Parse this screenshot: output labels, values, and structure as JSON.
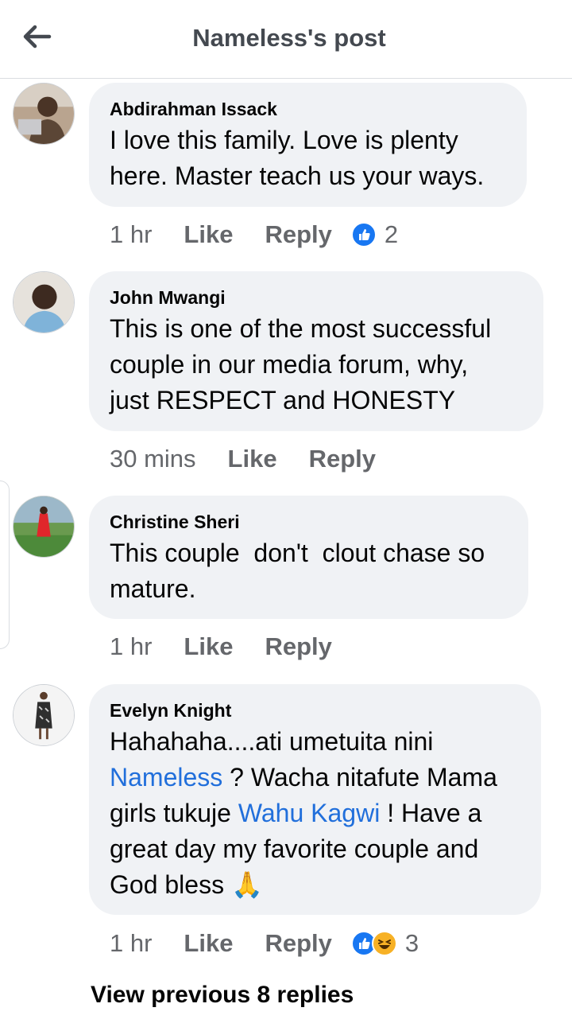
{
  "header": {
    "title": "Nameless's post"
  },
  "comments": [
    {
      "author": "Abdirahman Issack",
      "text": "I love this family. Love is plenty\nhere. Master teach us your ways.",
      "time": "1 hr",
      "like": "Like",
      "reply": "Reply",
      "reactions": {
        "types": [
          "like"
        ],
        "count": "2"
      }
    },
    {
      "author": "John Mwangi",
      "text": "This is one of the most successful\ncouple in our media forum, why,\njust RESPECT and HONESTY",
      "time": "30 mins",
      "like": "Like",
      "reply": "Reply"
    },
    {
      "author": "Christine Sheri",
      "text": "This couple  don't  clout chase so\nmature.",
      "time": "1 hr",
      "like": "Like",
      "reply": "Reply"
    },
    {
      "author": "Evelyn Knight",
      "text_parts": {
        "p1": "Hahahaha....ati umetuita nini\n",
        "m1": "Nameless",
        "p2": " ? Wacha nitafute Mama\ngirls tukuje ",
        "m2": "Wahu Kagwi",
        "p3": " ! Have a\ngreat day my favorite couple and\nGod bless ",
        "emoji": "🙏"
      },
      "time": "1 hr",
      "like": "Like",
      "reply": "Reply",
      "reactions": {
        "types": [
          "like",
          "haha"
        ],
        "count": "3"
      }
    }
  ],
  "view_previous": "View previous 8 replies",
  "colors": {
    "bubble": "#f0f2f5",
    "mention": "#216fdb",
    "meta": "#65676b",
    "like": "#1877f2",
    "haha": "#f7b125"
  }
}
